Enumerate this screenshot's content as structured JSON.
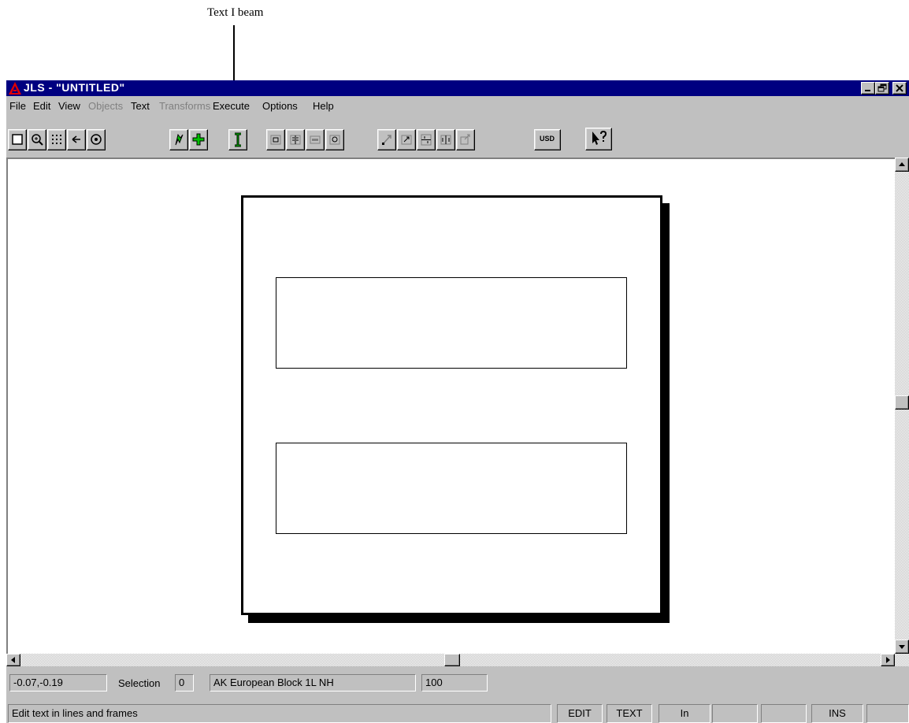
{
  "annotation": {
    "label": "Text I beam"
  },
  "window": {
    "title": "JLS - \"UNTITLED\"",
    "minimize": "_",
    "restore": "🗗",
    "close": "✕"
  },
  "menu": [
    {
      "label": "File",
      "disabled": false
    },
    {
      "label": "Edit",
      "disabled": false
    },
    {
      "label": "View",
      "disabled": false
    },
    {
      "label": "Objects",
      "disabled": true
    },
    {
      "label": "Text",
      "disabled": false
    },
    {
      "label": "Transforms",
      "disabled": true
    },
    {
      "label": "Execute",
      "disabled": false
    },
    {
      "label": "Options",
      "disabled": false
    },
    {
      "label": "Help",
      "disabled": false
    }
  ],
  "toolbar": {
    "usd_label": "USD"
  },
  "status": {
    "coordinates": "-0.07,-0.19",
    "selection_label": "Selection",
    "selection_value": "0",
    "font": "AK European Block 1L NH",
    "size": "100",
    "message": "Edit text in lines and frames",
    "mode_edit": "EDIT",
    "mode_text": "TEXT",
    "units": "In",
    "ins": "INS"
  },
  "colors": {
    "title_bar": "#000080",
    "face": "#c0c0c0",
    "accent_green": "#00c000"
  }
}
